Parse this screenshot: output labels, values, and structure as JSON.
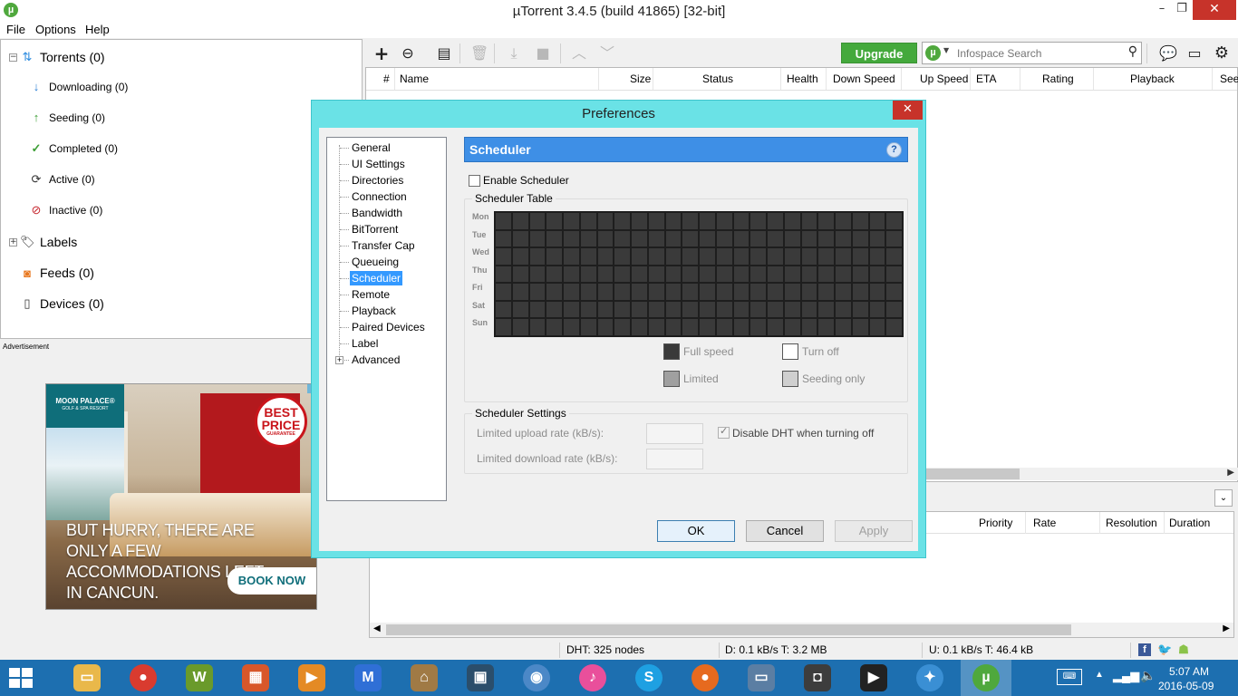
{
  "window": {
    "title": "µTorrent 3.4.5  (build 41865) [32-bit]",
    "min": "–",
    "max": "❐",
    "close": "✕"
  },
  "menu": [
    "File",
    "Options",
    "Help"
  ],
  "sidebar": {
    "torrents": "Torrents (0)",
    "items": [
      "Downloading (0)",
      "Seeding (0)",
      "Completed (0)",
      "Active (0)",
      "Inactive (0)"
    ],
    "labels": "Labels",
    "feeds": "Feeds (0)",
    "devices": "Devices (0)"
  },
  "ad": {
    "label": "Advertisement",
    "logo_line1": "MOON PALACE®",
    "logo_line2": "GOLF & SPA RESORT",
    "badge_line1": "BEST PRICE",
    "badge_line2": "GUARANTEE",
    "headline": "But hurry, there are only a few accommodations left in Cancun.",
    "cta": "BOOK NOW"
  },
  "toolbar": {
    "upgrade": "Upgrade",
    "search_placeholder": "Infospace Search"
  },
  "list_columns": [
    "#",
    "Name",
    "Size",
    "Status",
    "Health",
    "Down Speed",
    "Up Speed",
    "ETA",
    "Rating",
    "Playback",
    "See"
  ],
  "detail_columns": [
    "Priority",
    "Rate",
    "Resolution",
    "Duration"
  ],
  "statusbar": {
    "dht": "DHT: 325 nodes",
    "down": "D: 0.1 kB/s T: 3.2 MB",
    "up": "U: 0.1 kB/s T: 46.4 kB"
  },
  "taskbar": {
    "time": "5:07 AM",
    "date": "2016-05-09"
  },
  "prefs": {
    "title": "Preferences",
    "tree": [
      "General",
      "UI Settings",
      "Directories",
      "Connection",
      "Bandwidth",
      "BitTorrent",
      "Transfer Cap",
      "Queueing",
      "Scheduler",
      "Remote",
      "Playback",
      "Paired Devices",
      "Label",
      "Advanced"
    ],
    "selected": "Scheduler",
    "section_title": "Scheduler",
    "enable_label": "Enable Scheduler",
    "enable_checked": false,
    "table_title": "Scheduler Table",
    "days": [
      "Mon",
      "Tue",
      "Wed",
      "Thu",
      "Fri",
      "Sat",
      "Sun"
    ],
    "legend": {
      "full": "Full speed",
      "off": "Turn off",
      "limited": "Limited",
      "seeding": "Seeding only"
    },
    "settings_title": "Scheduler Settings",
    "upload_label": "Limited upload rate (kB/s):",
    "download_label": "Limited download rate (kB/s):",
    "dht_label": "Disable DHT when turning off",
    "dht_checked": true,
    "ok": "OK",
    "cancel": "Cancel",
    "apply": "Apply"
  },
  "colors": {
    "accent": "#3e8fe6",
    "upgrade": "#44a93c",
    "dialog_frame": "#6ae2e6",
    "taskbar": "#1d6fb0",
    "grid_cell": "#3a3a3a"
  }
}
